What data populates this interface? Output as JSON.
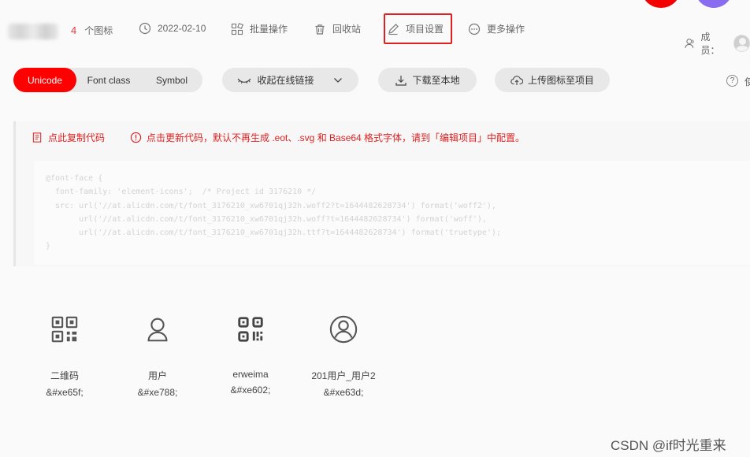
{
  "header": {
    "icon_count": "4",
    "icon_count_label": "个图标",
    "date": "2022-02-10",
    "batch": "批量操作",
    "recycle": "回收站",
    "settings": "项目设置",
    "more": "更多操作",
    "members": "成员：",
    "highlight_color": "#e02020"
  },
  "toolbar": {
    "tabs": [
      {
        "label": "Unicode",
        "active": true
      },
      {
        "label": "Font class",
        "active": false
      },
      {
        "label": "Symbol",
        "active": false
      }
    ],
    "collapse_link": "收起在线链接",
    "download": "下载至本地",
    "upload": "上传图标至项目",
    "help_label": "?",
    "help_text": "使",
    "accent": "#ff0000"
  },
  "code_panel": {
    "copy_code": "点此复制代码",
    "update_notice": "点击更新代码，默认不再生成 .eot、.svg 和 Base64 格式字体，请到「编辑项目」中配置。",
    "lines": [
      "@font-face {",
      "  font-family: 'element-icons';  /* Project id 3176210 */",
      "  src: url('//at.alicdn.com/t/font_3176210_xw6701qj32h.woff2?t=1644482628734') format('woff2'),",
      "       url('//at.alicdn.com/t/font_3176210_xw6701qj32h.woff?t=1644482628734') format('woff'),",
      "       url('//at.alicdn.com/t/font_3176210_xw6701qj32h.ttf?t=1644482628734') format('truetype');",
      "}"
    ]
  },
  "icons": [
    {
      "icon": "qrcode-icon",
      "name": "二维码",
      "code": "&#xe65f;"
    },
    {
      "icon": "user-icon",
      "name": "用户",
      "code": "&#xe788;"
    },
    {
      "icon": "qrcode-alt-icon",
      "name": "erweima",
      "code": "&#xe602;"
    },
    {
      "icon": "user-circle-icon",
      "name": "201用户_用户2",
      "code": "&#xe63d;"
    }
  ],
  "watermark": "CSDN @if时光重来"
}
